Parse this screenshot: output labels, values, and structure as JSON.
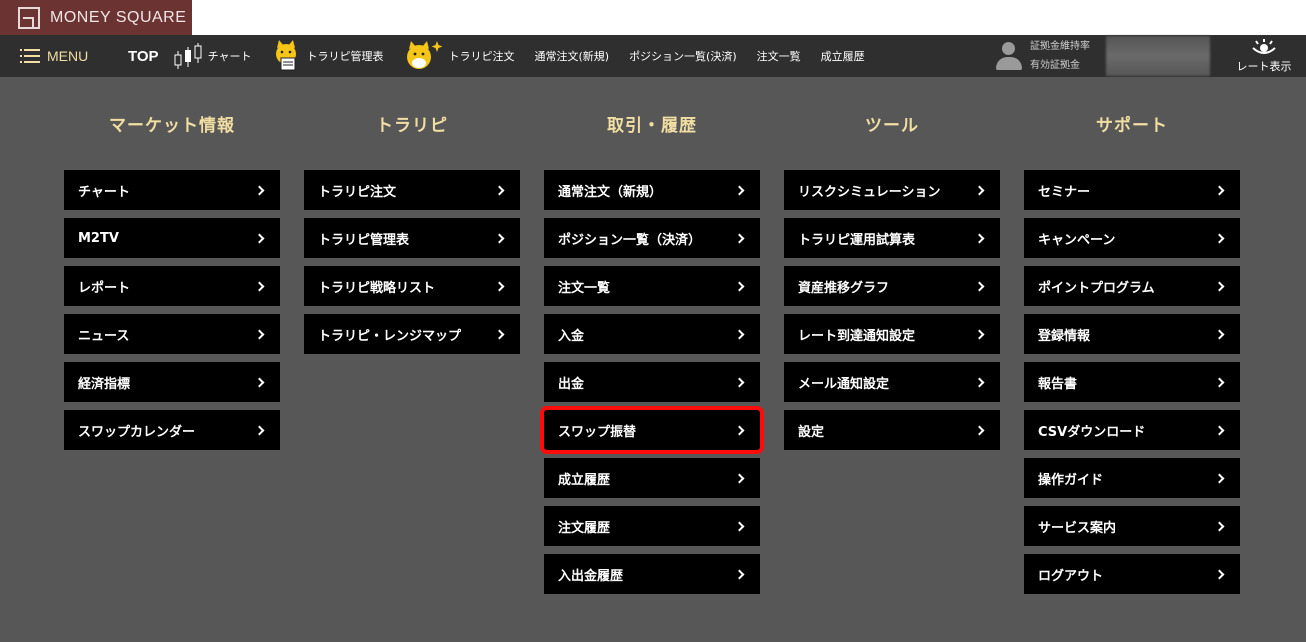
{
  "brand": {
    "name": "MONEY SQUARE"
  },
  "navbar": {
    "menu_label": "MENU",
    "items": [
      {
        "label": "TOP",
        "icon": "none"
      },
      {
        "label": "チャート",
        "icon": "candlestick-icon"
      },
      {
        "label": "トラリピ管理表",
        "icon": "mascot-cat-icon"
      },
      {
        "label": "トラリピ注文",
        "icon": "mascot-sparkle-icon"
      },
      {
        "label": "通常注文(新規)"
      },
      {
        "label": "ポジション一覧(決済)"
      },
      {
        "label": "注文一覧"
      },
      {
        "label": "成立履歴"
      }
    ],
    "account": {
      "margin_ratio_label": "証拠金維持率",
      "effective_margin_label": "有効証拠金"
    },
    "rate_display_label": "レート表示"
  },
  "columns": [
    {
      "title": "マーケット情報",
      "items": [
        "チャート",
        "M2TV",
        "レポート",
        "ニュース",
        "経済指標",
        "スワップカレンダー"
      ]
    },
    {
      "title": "トラリピ",
      "items": [
        "トラリピ注文",
        "トラリピ管理表",
        "トラリピ戦略リスト",
        "トラリピ・レンジマップ"
      ]
    },
    {
      "title": "取引・履歴",
      "items": [
        "通常注文（新規）",
        "ポジション一覧（決済）",
        "注文一覧",
        "入金",
        "出金",
        "スワップ振替",
        "成立履歴",
        "注文履歴",
        "入出金履歴"
      ],
      "highlighted": "スワップ振替"
    },
    {
      "title": "ツール",
      "items": [
        "リスクシミュレーション",
        "トラリピ運用試算表",
        "資産推移グラフ",
        "レート到達通知設定",
        "メール通知設定",
        "設定"
      ]
    },
    {
      "title": "サポート",
      "items": [
        "セミナー",
        "キャンペーン",
        "ポイントプログラム",
        "登録情報",
        "報告書",
        "CSVダウンロード",
        "操作ガイド",
        "サービス案内",
        "ログアウト"
      ]
    }
  ],
  "colors": {
    "accent": "#f1dea2",
    "highlight": "#ff0b0b",
    "logo_bg": "#6b3433",
    "navbar_bg": "#2f2f2f",
    "page_bg": "#575757"
  }
}
